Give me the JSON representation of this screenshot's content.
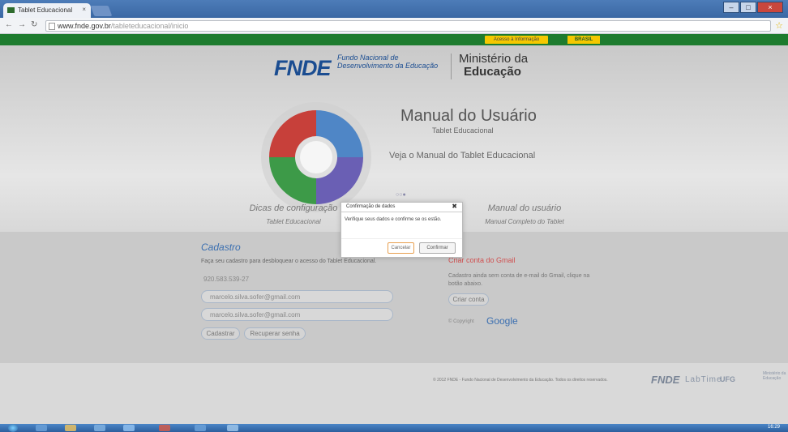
{
  "browser": {
    "tab_title": "Tablet Educacional",
    "tab_close": "×",
    "url_domain": "www.fnde.gov.br",
    "url_path": "/tableteducacional/inicio",
    "win_min": "–",
    "win_max": "□",
    "win_close": "×"
  },
  "govbar": {
    "acesso": "Acesso à Informação",
    "brasil": "BRASIL"
  },
  "header": {
    "fnde_logo": "FNDE",
    "fnde_line1": "Fundo Nacional de",
    "fnde_line2": "Desenvolvimento da Educação",
    "ministerio_line1": "Ministério da",
    "ministerio_line2": "Educação"
  },
  "hero": {
    "title": "Manual do Usuário",
    "subtitle": "Tablet Educacional",
    "cta": "Veja o Manual do Tablet Educacional",
    "dots": "○○●"
  },
  "quick_links": [
    {
      "title": "Dicas de configuração",
      "subtitle": "Tablet Educacional"
    },
    {
      "title": "Manual do usuário",
      "subtitle": "Manual Completo do Tablet"
    }
  ],
  "cadastro": {
    "title": "Cadastro",
    "description": "Faça seu cadastro para desbloquear o acesso do Tablet Educacional.",
    "cpf_value": "920.583.539-27",
    "email_value": "marcelo.silva.sofer@gmail.com",
    "email_confirm_value": "marcelo.silva.sofer@gmail.com",
    "submit_label": "Cadastrar",
    "recover_label": "Recuperar senha"
  },
  "gmail": {
    "title": "Criar conta do Gmail",
    "text": "Cadastro ainda sem conta de e-mail do Gmail, clique na botão abaixo.",
    "button_label": "Criar conta",
    "copyright_prefix": "© Copyright",
    "google": "Google"
  },
  "footer": {
    "copyright": "© 2012 FNDE - Fundo Nacional de Desenvolvimento da Educação. Todos os direitos reservados.",
    "fnde": "FNDE",
    "labtime": "LabTime",
    "ufg": "UFG",
    "ministerio": "Ministério da Educação"
  },
  "modal": {
    "title": "Confirmação de dados",
    "close": "✖",
    "body": "Verifique seus dados e confirme se os estão.",
    "cancel_label": "Cancelar",
    "confirm_label": "Confirmar"
  },
  "taskbar": {
    "clock": "16:29"
  },
  "colors": {
    "govbar_green": "#1d7b2e",
    "brand_blue": "#1b4d91",
    "accent_yellow": "#f5c800"
  }
}
